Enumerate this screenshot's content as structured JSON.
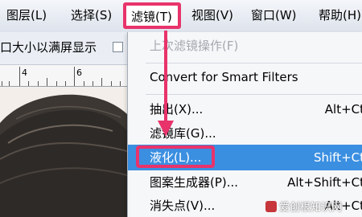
{
  "menubar": {
    "items": [
      {
        "label": "图层(L)"
      },
      {
        "label": "选择(S)"
      },
      {
        "label": "滤镜(T)"
      },
      {
        "label": "视图(V)"
      },
      {
        "label": "窗口(W)"
      },
      {
        "label": "帮助(H)"
      }
    ]
  },
  "options_bar": {
    "label": "口大小以满屏显示"
  },
  "ruler": {
    "numbers": [
      "4",
      "6"
    ]
  },
  "filter_menu": {
    "items": [
      {
        "label": "上次滤镜操作(F)",
        "shortcut": "",
        "enabled": false
      },
      {
        "label": "Convert for Smart Filters",
        "shortcut": ""
      },
      {
        "label": "抽出(X)...",
        "shortcut": "Alt+Ct"
      },
      {
        "label": "滤镜库(G)...",
        "shortcut": ""
      },
      {
        "label": "液化(L)...",
        "shortcut": "Shift+Ct",
        "highlighted": true
      },
      {
        "label": "图案生成器(P)...",
        "shortcut": "Alt+Shift+Ct"
      },
      {
        "label": "消失点(V)...",
        "shortcut": "Alt+Ct"
      }
    ]
  },
  "watermark": {
    "text": "爱创根知识网"
  },
  "colors": {
    "annotation": "#e8336b",
    "highlight": "#3b8fe1",
    "menubar": "#e6eaf0"
  }
}
